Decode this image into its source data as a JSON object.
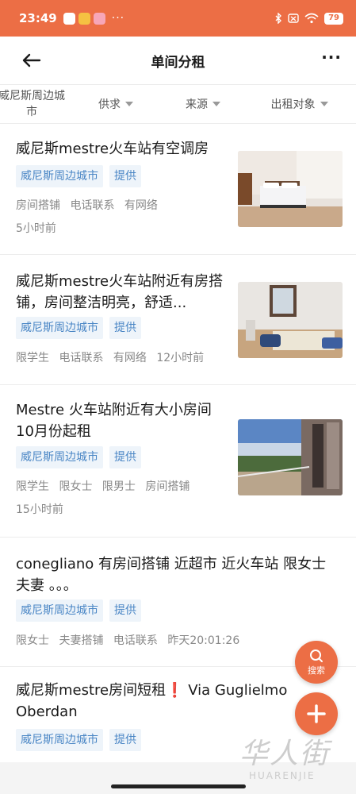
{
  "status_bar": {
    "time": "23:49",
    "battery": "79",
    "bg_color": "#ec6e45"
  },
  "nav": {
    "title": "单间分租",
    "back_icon": "arrow-left-icon",
    "more_label": "···"
  },
  "filters": [
    {
      "label": "威尼斯周边城市"
    },
    {
      "label": "供求"
    },
    {
      "label": "来源"
    },
    {
      "label": "出租对象"
    }
  ],
  "listings": [
    {
      "title": "威尼斯mestre火车站有空调房",
      "tags": [
        "威尼斯周边城市",
        "提供"
      ],
      "meta": [
        "房间搭铺",
        "电话联系",
        "有网络"
      ],
      "time": "5小时前",
      "image": "bedroom-photo"
    },
    {
      "title": "威尼斯mestre火车站附近有房搭铺，房间整洁明亮，舒适...",
      "tags": [
        "威尼斯周边城市",
        "提供"
      ],
      "meta": [
        "限学生",
        "电话联系",
        "有网络",
        "12小时前"
      ],
      "image": "room-with-window-photo"
    },
    {
      "title": "Mestre 火车站附近有大小房间10月份起租",
      "tags": [
        "威尼斯周边城市",
        "提供"
      ],
      "meta": [
        "限学生",
        "限女士",
        "限男士",
        "房间搭铺"
      ],
      "time": "15小时前",
      "image": "balcony-photo"
    },
    {
      "title": "conegliano 有房间搭铺 近超市 近火车站 限女士 夫妻 。。。",
      "tags": [
        "威尼斯周边城市",
        "提供"
      ],
      "meta": [
        "限女士",
        "夫妻搭铺",
        "电话联系",
        "昨天20:01:26"
      ]
    },
    {
      "title": "威尼斯mestre房间短租❗ Via Guglielmo Oberdan",
      "tags": [
        "威尼斯周边城市",
        "提供"
      ]
    }
  ],
  "fab": {
    "search_label": "搜索",
    "add_icon": "plus-icon",
    "color": "#ec6e45"
  },
  "watermark": {
    "cn": "华人街",
    "en": "HUARENJIE"
  }
}
